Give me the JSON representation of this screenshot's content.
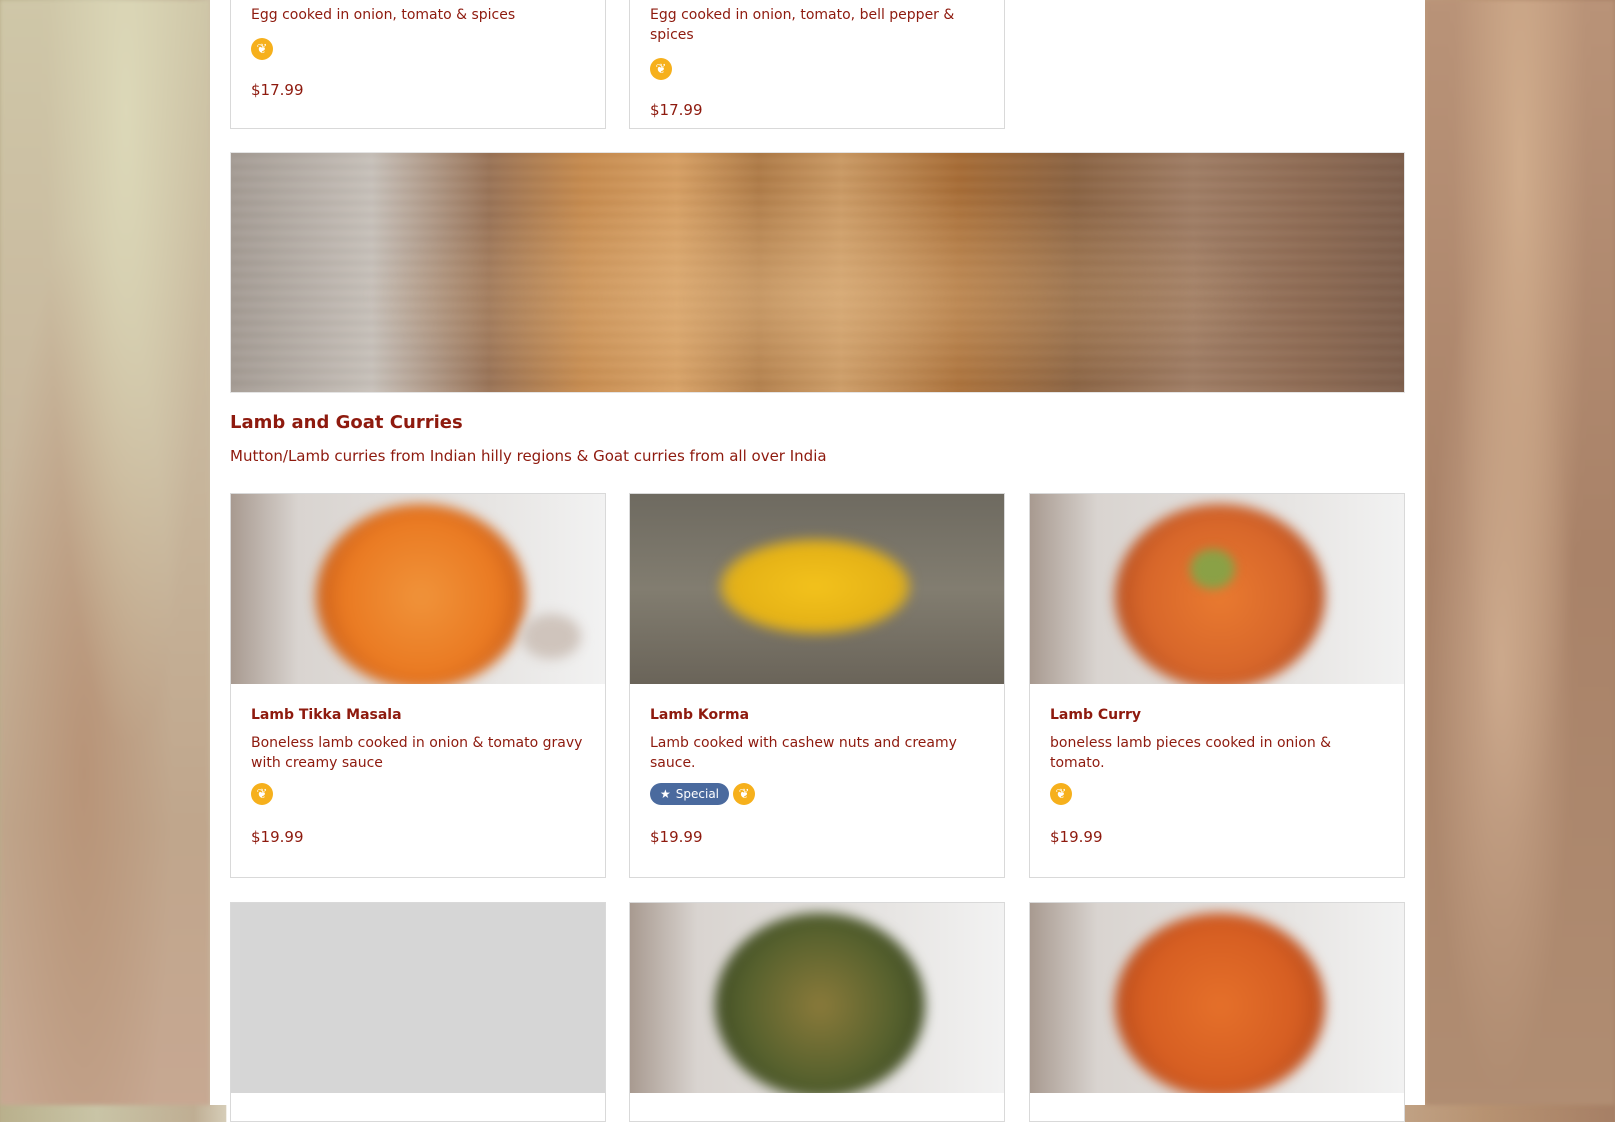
{
  "top_cards": [
    {
      "description": "Egg cooked in onion, tomato & spices",
      "price": "$17.99",
      "tag_icon": "wheat-icon"
    },
    {
      "description": "Egg cooked in onion, tomato, bell pepper & spices",
      "price": "$17.99",
      "tag_icon": "wheat-icon"
    }
  ],
  "section": {
    "title": "Lamb and Goat Curries",
    "subtitle": "Mutton/Lamb curries from Indian hilly regions & Goat curries from all over India"
  },
  "items": [
    {
      "title": "Lamb Tikka Masala",
      "description": "Boneless lamb cooked in onion & tomato gravy with creamy sauce",
      "price": "$19.99",
      "tag_icon": "wheat-icon"
    },
    {
      "title": "Lamb Korma",
      "description": "Lamb cooked with cashew nuts and creamy sauce.",
      "price": "$19.99",
      "special_label": "Special",
      "tag_icon": "wheat-icon"
    },
    {
      "title": "Lamb Curry",
      "description": "boneless lamb pieces cooked in onion & tomato.",
      "price": "$19.99",
      "tag_icon": "wheat-icon"
    }
  ],
  "colors": {
    "accent": "#8e1a0e",
    "gluten_badge": "#f6b01c",
    "special_badge": "#4a6a9e"
  }
}
